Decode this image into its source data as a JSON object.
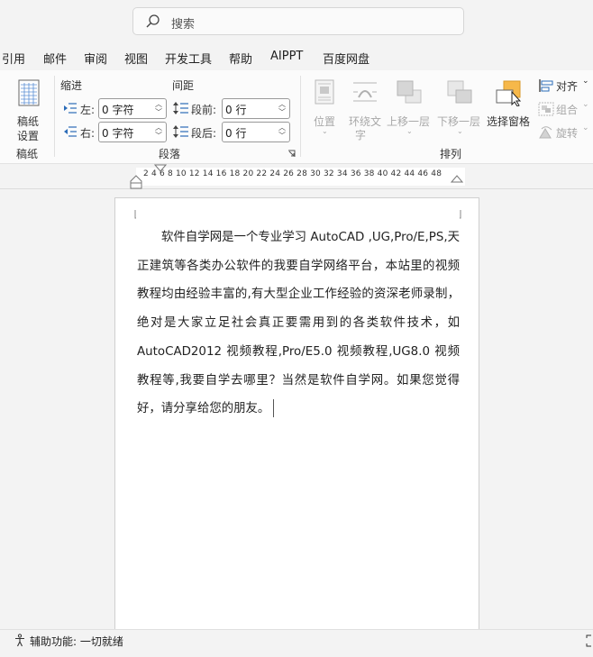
{
  "search": {
    "placeholder": "搜索"
  },
  "tabs": [
    "引用",
    "邮件",
    "审阅",
    "视图",
    "开发工具",
    "帮助",
    "AIPPT",
    "百度网盘"
  ],
  "manuscript": {
    "button_label_line1": "稿纸",
    "button_label_line2": "设置",
    "group_label": "稿纸"
  },
  "paragraph": {
    "indent_header": "缩进",
    "spacing_header": "间距",
    "left_label": "左:",
    "left_value": "0 字符",
    "right_label": "右:",
    "right_value": "0 字符",
    "before_label": "段前:",
    "before_value": "0 行",
    "after_label": "段后:",
    "after_value": "0 行",
    "group_label": "段落"
  },
  "arrange": {
    "position_label": "位置",
    "wrap_text_line1": "环绕文",
    "wrap_text_line2": "字",
    "bring_forward": "上移一层",
    "send_backward": "下移一层",
    "selection_pane": "选择窗格",
    "align": "对齐",
    "group": "组合",
    "rotate": "旋转",
    "group_label": "排列"
  },
  "ruler": {
    "numbers": "2  4  6  8  10  12  14  16  18  20  22  24  26  28  30  32  34  36  38  40  42  44  46  48"
  },
  "document": {
    "paragraph": "软件自学网是一个专业学习 AutoCAD ,UG,Pro/E,PS,天正建筑等各类办公软件的我要自学网络平台，本站里的视频教程均由经验丰富的,有大型企业工作经验的资深老师录制，绝对是大家立足社会真正要需用到的各类软件技术，如AutoCAD2012 视频教程,Pro/E5.0 视频教程,UG8.0 视频教程等,我要自学去哪里？当然是软件自学网。如果您觉得好，请分享给您的朋友。"
  },
  "status": {
    "accessibility": "辅助功能: 一切就绪"
  },
  "colors": {
    "accent_orange": "#f6b84a",
    "blue_icon": "#2b6cb8"
  }
}
